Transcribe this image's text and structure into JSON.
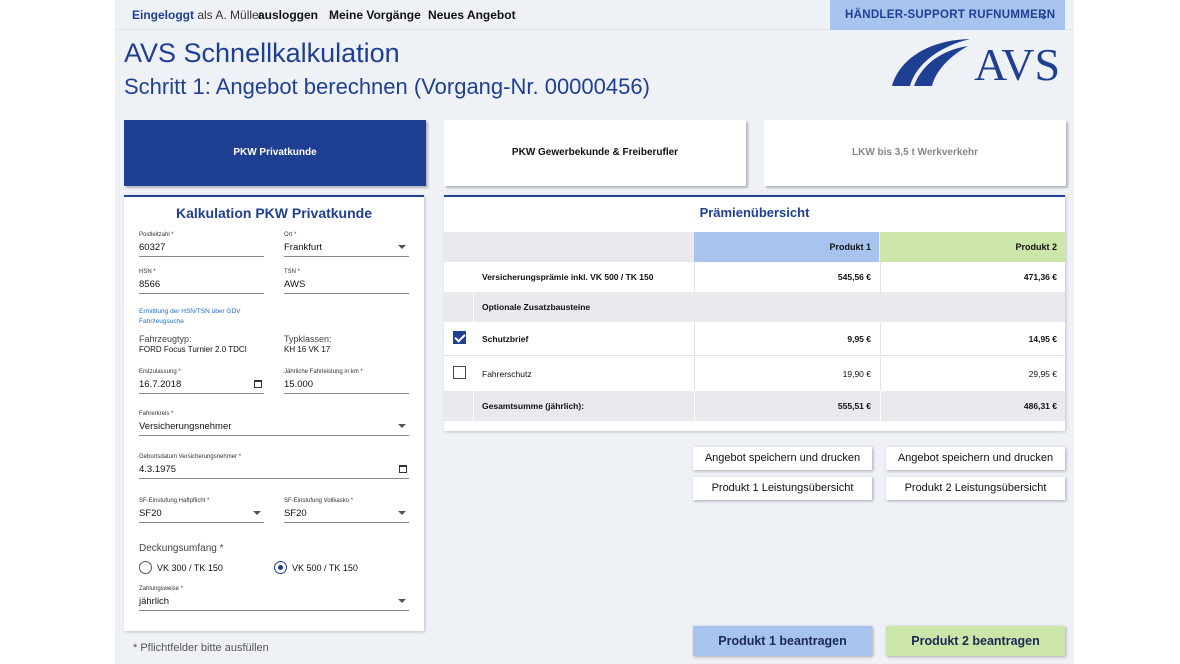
{
  "topbar": {
    "logged_in_label": "Eingeloggt",
    "logged_in_as": "als A. Müller",
    "logout": "ausloggen",
    "my_processes": "Meine Vorgänge",
    "new_offer": "Neues Angebot",
    "support": "HÄNDLER-SUPPORT RUFNUMMERN"
  },
  "header": {
    "title": "AVS Schnellkalkulation",
    "subtitle": "Schritt 1: Angebot berechnen (Vorgang-Nr. 00000456)",
    "logo_text": "AVS"
  },
  "tabs": [
    {
      "label": "PKW Privatkunde",
      "state": "active"
    },
    {
      "label": "PKW Gewerbekunde & Freiberufler",
      "state": "normal"
    },
    {
      "label": "LKW bis 3,5 t Werkverkehr",
      "state": "disabled"
    }
  ],
  "form": {
    "title": "Kalkulation PKW Privatkunde",
    "plz": {
      "label": "Postleitzahl *",
      "value": "60327"
    },
    "ort": {
      "label": "Ort *",
      "value": "Frankfurt"
    },
    "hsn": {
      "label": "HSN *",
      "value": "8566"
    },
    "tsn": {
      "label": "TSN *",
      "value": "AWS"
    },
    "hsn_link": "Ermittlung der HSN/TSN über GDV Fahrzeugsuche",
    "vehicle_type": {
      "label": "Fahrzeugtyp:",
      "value": "FORD Focus Turnier 2.0 TDCI"
    },
    "type_classes": {
      "label": "Typklassen:",
      "value": "KH 16 VK 17"
    },
    "erstzulassung": {
      "label": "Erstzulassung *",
      "value": "16.7.2018"
    },
    "fahrleistung": {
      "label": "Jährliche Fahrleistung in km *",
      "value": "15.000"
    },
    "fahrerkreis": {
      "label": "Fahrerkreis *",
      "value": "Versicherungsnehmer"
    },
    "geburtsdatum": {
      "label": "Geburtsdatum Versicherungsnehmer *",
      "value": "4.3.1975"
    },
    "sf_haftpflicht": {
      "label": "SF-Einstufung Haftpflicht *",
      "value": "SF20"
    },
    "sf_vollkasko": {
      "label": "SF-Einstufung Vollkasko *",
      "value": "SF20"
    },
    "deckungsumfang": {
      "label": "Deckungsumfang *",
      "options": [
        {
          "label": "VK 300 / TK 150",
          "selected": false
        },
        {
          "label": "VK 500 / TK 150",
          "selected": true
        }
      ]
    },
    "zahlungsweise": {
      "label": "Zahlungsweise *",
      "value": "jährlich"
    },
    "required_hint": "* Pflichtfelder bitte ausfüllen"
  },
  "premium": {
    "title": "Prämienübersicht",
    "col1": "Produkt 1",
    "col2": "Produkt 2",
    "premium_row": {
      "label": "Versicherungsprämie inkl. VK 500 / TK 150",
      "v1": "545,56 €",
      "v2": "471,36 €"
    },
    "optional_label": "Optionale Zusatzbausteine",
    "options": [
      {
        "label": "Schutzbrief",
        "checked": true,
        "v1": "9,95 €",
        "v2": "14,95 €"
      },
      {
        "label": "Fahrerschutz",
        "checked": false,
        "v1": "19,90 €",
        "v2": "29,95 €"
      }
    ],
    "total": {
      "label": "Gesamtsumme (jährlich):",
      "v1": "555,51 €",
      "v2": "486,31 €"
    }
  },
  "actions": {
    "save_print_1": "Angebot speichern und drucken",
    "save_print_2": "Angebot speichern und drucken",
    "overview_1": "Produkt 1 Leistungsübersicht",
    "overview_2": "Produkt 2 Leistungsübersicht",
    "apply_1": "Produkt 1 beantragen",
    "apply_2": "Produkt 2 beantragen"
  },
  "colors": {
    "brand": "#1f3f93",
    "product1": "#a8c4ee",
    "product2": "#cce5a8",
    "row_gray": "#e9e9ee"
  }
}
